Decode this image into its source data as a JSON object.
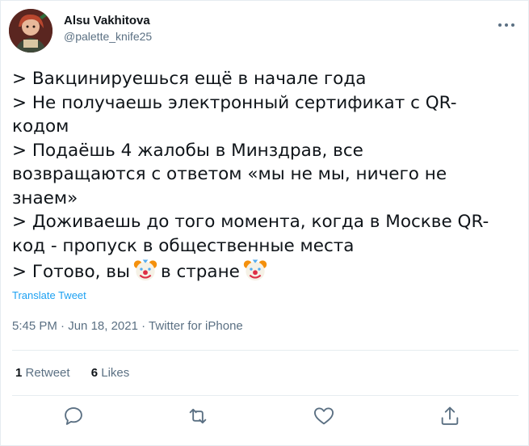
{
  "author": {
    "display_name": "Alsu Vakhitova",
    "handle": "@palette_knife25"
  },
  "tweet": {
    "lines": [
      "> Вакцинируешься ещё в начале года",
      "> Не получаешь электронный сертификат с QR-",
      "кодом",
      "> Подаёшь 4 жалобы в Минздрав, все",
      "возвращаются с ответом «мы не мы, ничего не",
      "знаем»",
      "> Доживаешь до того момента, когда в Москве QR-",
      "код - пропуск в общественные места"
    ],
    "last_line_part1": "> Готово, вы",
    "last_line_part2": "в стране",
    "emoji_name": "clown-face-emoji",
    "translate_label": "Translate Tweet"
  },
  "meta": {
    "time": "5:45 PM",
    "separator": "·",
    "date": "Jun 18, 2021",
    "source": "Twitter for iPhone"
  },
  "stats": {
    "retweets_count": "1",
    "retweets_label": "Retweet",
    "likes_count": "6",
    "likes_label": "Likes"
  },
  "icons": {
    "more": "more-icon",
    "reply": "reply-icon",
    "retweet": "retweet-icon",
    "like": "heart-icon",
    "share": "share-icon"
  },
  "colors": {
    "text": "#0f1419",
    "secondary": "#5b7083",
    "link": "#1da1f2",
    "divider": "#e6ecf0"
  }
}
